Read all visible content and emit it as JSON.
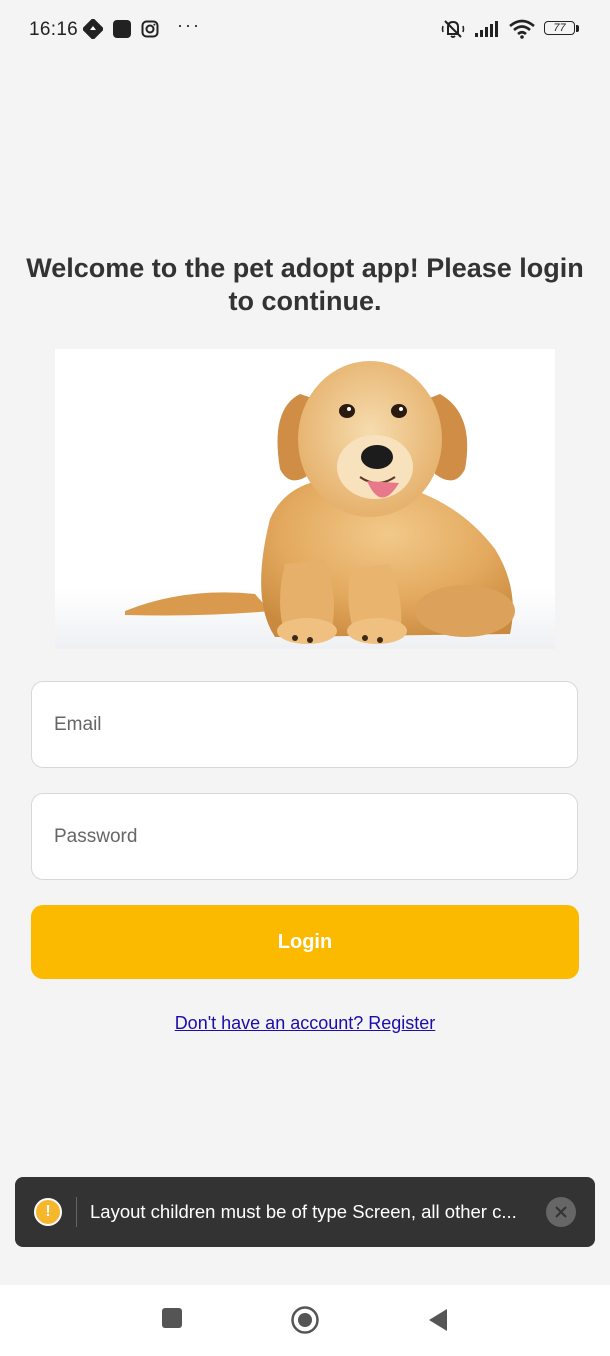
{
  "status_bar": {
    "time": "16:16",
    "left_icons": [
      "navigation-app-icon",
      "app-icon",
      "instagram-icon",
      "more-dots-icon"
    ],
    "more_dots": "···",
    "right_icons": [
      "silent-mode-icon",
      "signal-icon",
      "wifi-icon",
      "battery-icon"
    ],
    "battery_level": "77"
  },
  "heading": {
    "line1": "Welcome to the pet adopt app! Please login",
    "line2": "to continue."
  },
  "image": {
    "subject": "golden retriever puppy"
  },
  "form": {
    "email_placeholder": "Email",
    "password_placeholder": "Password",
    "login_label": "Login",
    "register_link": "Don't have an account? Register"
  },
  "toast": {
    "icon": "warning-icon",
    "message": "Layout children must be of type Screen, all other c...",
    "close_icon": "close-icon"
  },
  "nav_bar": {
    "buttons": [
      "recents-icon",
      "home-icon",
      "back-icon"
    ]
  },
  "colors": {
    "background": "#f4f4f4",
    "accent": "#fbba00",
    "toast_bg": "#333333",
    "warning": "#f7b72c",
    "link": "#1a0dab"
  }
}
